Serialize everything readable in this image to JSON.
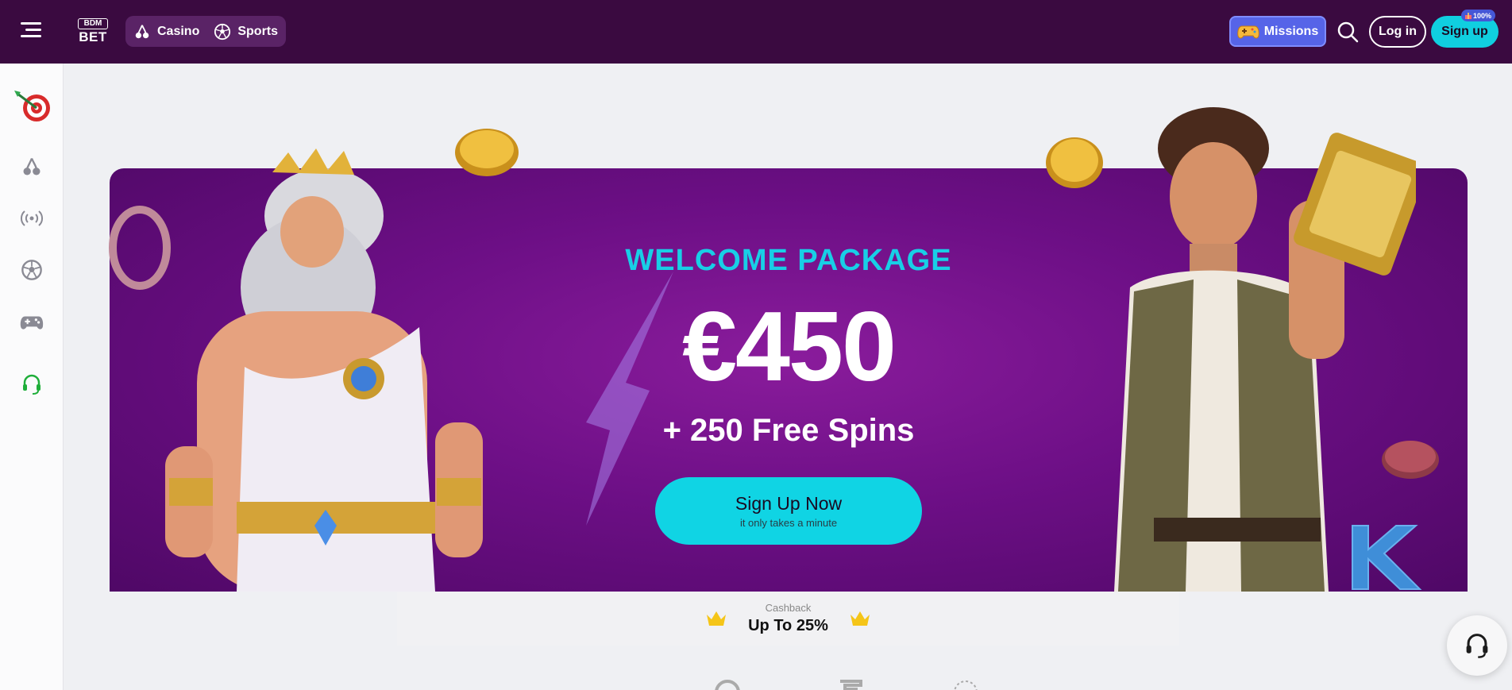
{
  "header": {
    "logo_top": "BDM",
    "logo_bottom": "BET",
    "nav": [
      {
        "label": "Casino",
        "icon": "cherry-icon"
      },
      {
        "label": "Sports",
        "icon": "soccer-ball-icon"
      }
    ],
    "missions_label": "Missions",
    "login_label": "Log in",
    "signup_label": "Sign up",
    "signup_badge": "100%"
  },
  "sidebar": {
    "items": [
      {
        "name": "target-dart-icon",
        "active": true
      },
      {
        "name": "cherry-icon"
      },
      {
        "name": "live-broadcast-icon"
      },
      {
        "name": "soccer-ball-icon"
      },
      {
        "name": "gamepad-icon"
      },
      {
        "name": "support-headset-icon"
      }
    ]
  },
  "banner": {
    "welcome": "WELCOME PACKAGE",
    "amount": "€450",
    "spins": "+ 250 Free Spins",
    "cta_label": "Sign Up Now",
    "cta_sub": "it only takes a minute"
  },
  "cashback": {
    "label": "Cashback",
    "value": "Up To 25%"
  },
  "colors": {
    "header_bg": "#3a0a40",
    "accent_cyan": "#10cfe0",
    "missions_bg": "#5664e8",
    "banner_purple": "#6d0f86",
    "support_green": "#1fae3a"
  }
}
